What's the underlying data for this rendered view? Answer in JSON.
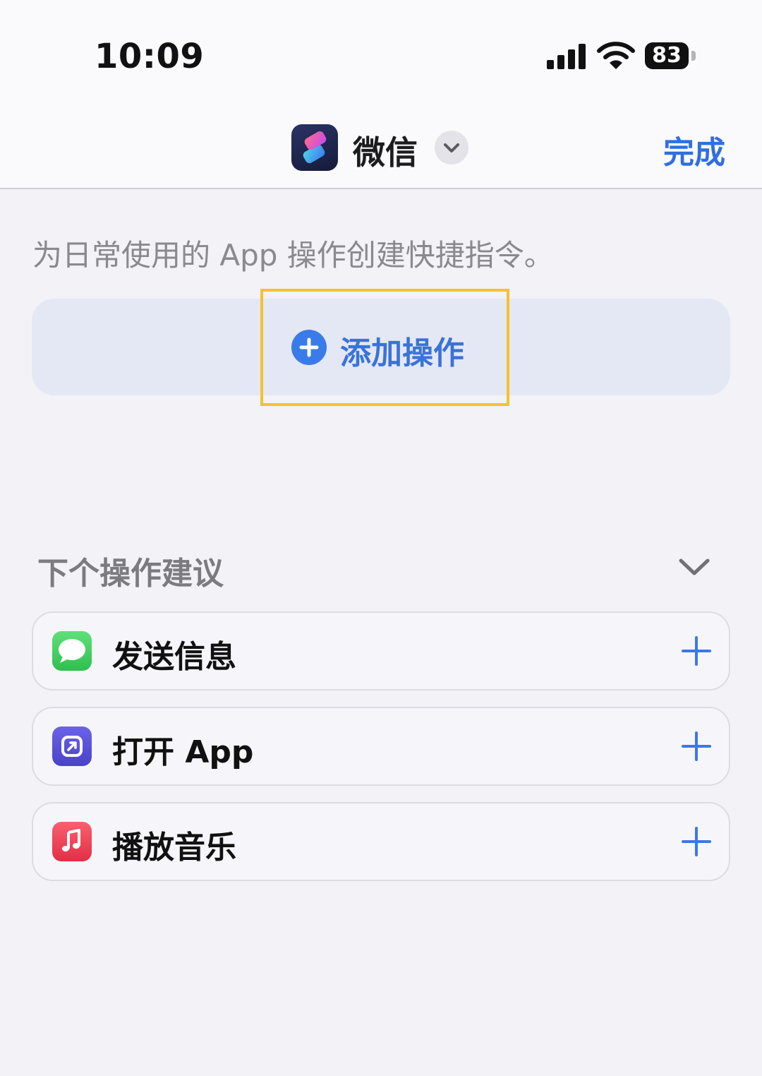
{
  "status_bar": {
    "time": "10:09",
    "battery_level": "83",
    "signal_icon": "cellular-signal-icon",
    "wifi_icon": "wifi-icon"
  },
  "nav": {
    "app_icon": "shortcuts-app-icon",
    "title": "微信",
    "chevron_icon": "chevron-down-icon",
    "done_label": "完成"
  },
  "main": {
    "description": "为日常使用的 App 操作创建快捷指令。",
    "add_action_label": "添加操作",
    "add_action_icon": "plus-circle-icon",
    "highlight_color": "#f6c12c"
  },
  "suggestions": {
    "heading": "下个操作建议",
    "toggle_icon": "chevron-down-icon",
    "items": [
      {
        "label": "发送信息",
        "icon": "messages-icon",
        "color": "#34c759"
      },
      {
        "label": "打开 App",
        "icon": "open-app-icon",
        "color": "#5b55d6"
      },
      {
        "label": "播放音乐",
        "icon": "music-icon",
        "color": "#f0404f"
      }
    ]
  },
  "colors": {
    "accent": "#2f6fe0",
    "background": "#f2f2f7",
    "secondary_text": "#8a8a8e"
  }
}
